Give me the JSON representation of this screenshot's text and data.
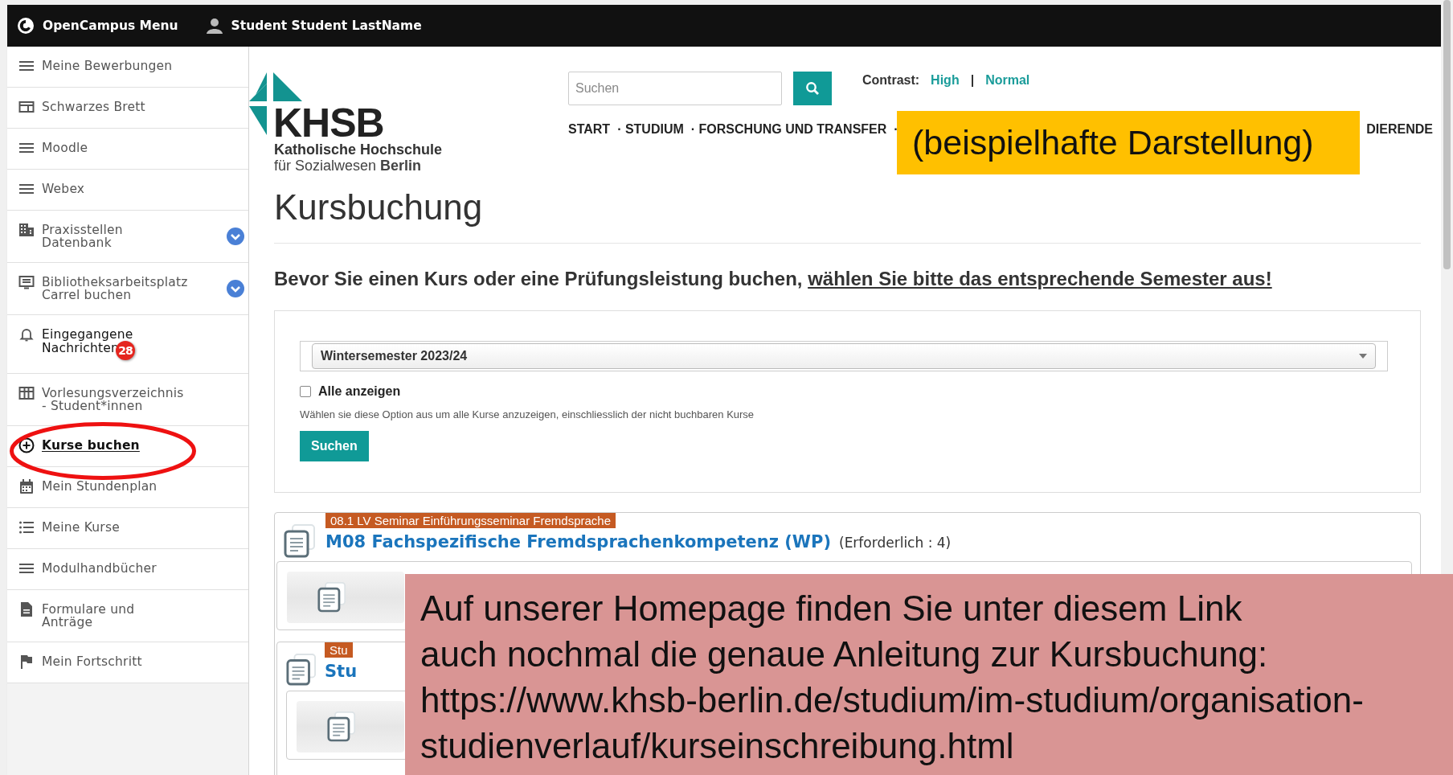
{
  "topbar": {
    "menu_label": "OpenCampus Menu",
    "user": "Student Student LastName"
  },
  "sidebar": {
    "items": [
      {
        "label": "Meine Bewerbungen",
        "kind": "link",
        "selected": false,
        "circled": false
      },
      {
        "label": "Schwarzes Brett",
        "kind": "link",
        "selected": false,
        "circled": false
      },
      {
        "label": "Moodle",
        "kind": "link",
        "selected": false,
        "circled": false
      },
      {
        "label": "Webex",
        "kind": "link",
        "selected": false,
        "circled": false
      },
      {
        "label": "Praxisstellen\nDatenbank",
        "kind": "expandable",
        "selected": false,
        "circled": false
      },
      {
        "label": "Bibliotheksarbeitsplatz\nCarrel buchen",
        "kind": "expandable",
        "selected": false,
        "circled": false
      },
      {
        "label": "Eingegangene\nNachrichten",
        "kind": "link",
        "badge": "28",
        "selected": false,
        "circled": false
      },
      {
        "label": "Vorlesungsverzeichnis\n- Student*innen",
        "kind": "link",
        "selected": false,
        "circled": false
      },
      {
        "label": "Kurse buchen",
        "kind": "link",
        "selected": true,
        "circled": true
      },
      {
        "label": "Mein Stundenplan",
        "kind": "link",
        "selected": false,
        "circled": false
      },
      {
        "label": "Meine Kurse",
        "kind": "link",
        "selected": false,
        "circled": false
      },
      {
        "label": "Modulhandbücher",
        "kind": "link",
        "selected": false,
        "circled": false
      },
      {
        "label": "Formulare und\nAnträge",
        "kind": "link",
        "selected": false,
        "circled": false
      },
      {
        "label": "Mein Fortschritt",
        "kind": "link",
        "selected": false,
        "circled": false
      }
    ]
  },
  "header": {
    "logo": {
      "name": "KHSB",
      "line1": "Katholische Hochschule",
      "line2": "für Sozialwesen **Berlin**"
    },
    "search": {
      "placeholder": "Suchen"
    },
    "contrast": {
      "label": "Contrast:",
      "options": [
        "High",
        "Normal"
      ],
      "separator": "|"
    },
    "nav": [
      "START",
      "· STUDIUM",
      "· FORSCHUNG UND TRANSFER",
      "·"
    ],
    "nav_end": "DIERENDE"
  },
  "page": {
    "title": "Kursbuchung",
    "intro": "Bevor Sie einen Kurs oder eine Prüfungsleistung buchen,",
    "intro_link": "wählen Sie bitte das entsprechende Semester aus!"
  },
  "form": {
    "semester": {
      "value": "Wintersemester 2023/24"
    },
    "show_all": {
      "label": "Alle anzeigen",
      "checked": false
    },
    "hint": "Wählen sie diese Option aus um alle Kurse anzuzeigen, einschliesslich der nicht buchbaren Kurse",
    "submit": "Suchen"
  },
  "course": {
    "tag": "08.1 LV Seminar Einführungsseminar Fremdsprache",
    "title": "M08 Fachspezifische Fremdsprachenkompetenz (WP)",
    "note": "(Erforderlich : 4)",
    "children": [
      {
        "kind": "entry"
      },
      {
        "kind": "module",
        "tag": "Stu",
        "title": "Stu",
        "children": [
          {
            "kind": "entry"
          }
        ]
      }
    ]
  },
  "annotations": {
    "label": "(beispielhafte Darstellung)",
    "note": "Auf unserer Homepage finden Sie unter diesem Link\nauch nochmal die genaue Anleitung zur Kursbuchung:\nhttps://www.khsb-berlin.de/studium/im-studium/organisation-\nstudienverlauf/kurseinschreibung.html"
  }
}
